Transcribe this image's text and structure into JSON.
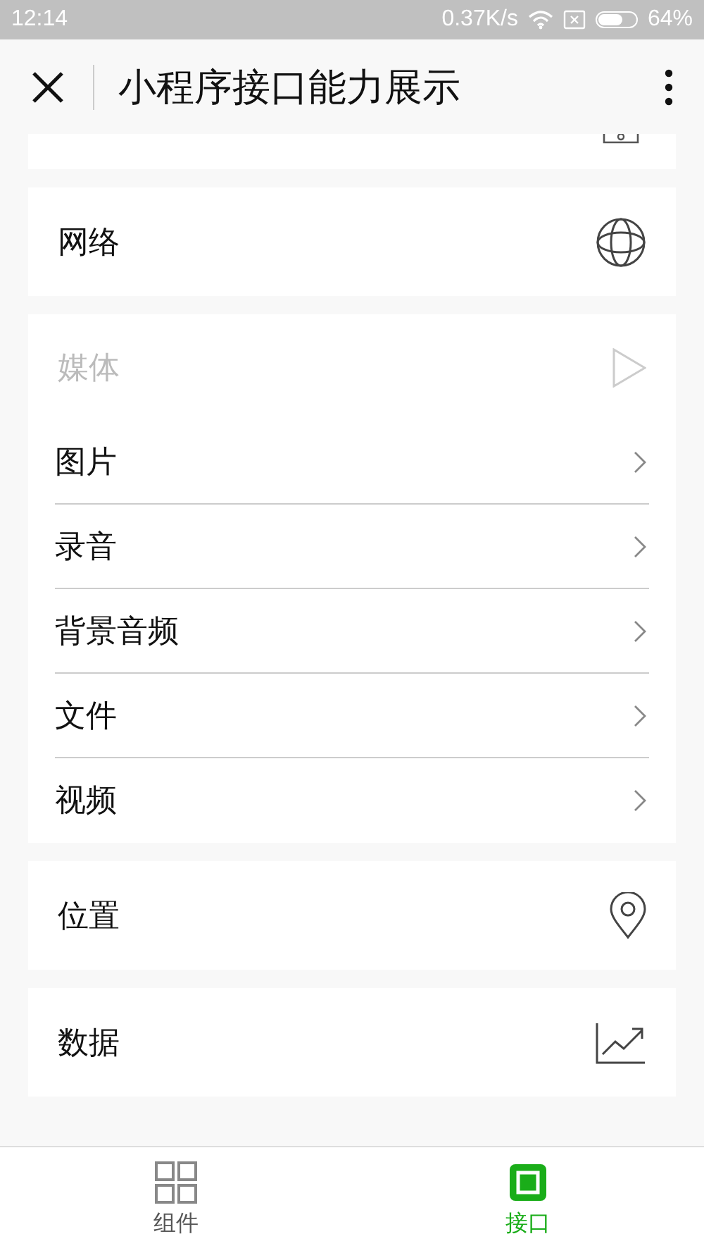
{
  "status_bar": {
    "time": "12:14",
    "speed": "0.37K/s",
    "battery": "64%"
  },
  "header": {
    "title": "小程序接口能力展示"
  },
  "sections": [
    {
      "kind": "network",
      "title": "网络",
      "expanded": false
    },
    {
      "kind": "media",
      "title": "媒体",
      "expanded": true,
      "items": [
        "图片",
        "录音",
        "背景音频",
        "文件",
        "视频"
      ]
    },
    {
      "kind": "location",
      "title": "位置",
      "expanded": false
    },
    {
      "kind": "data",
      "title": "数据",
      "expanded": false
    }
  ],
  "tab_bar": [
    {
      "kind": "grid",
      "label": "组件",
      "selected": false
    },
    {
      "kind": "chip",
      "label": "接口",
      "selected": true
    }
  ]
}
